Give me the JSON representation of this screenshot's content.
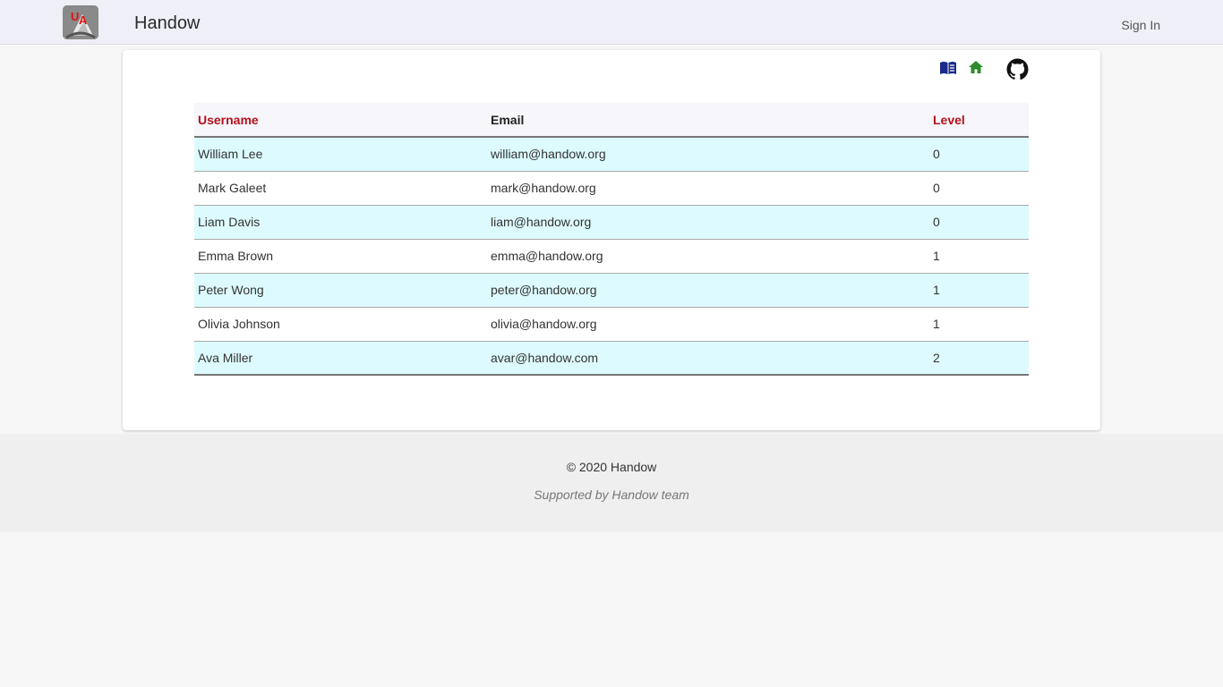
{
  "header": {
    "app_name": "Handow",
    "sign_in_label": "Sign In",
    "logo_icon": "handow-logo"
  },
  "toolbar": {
    "icons": [
      "book-icon",
      "home-icon",
      "github-icon"
    ],
    "colors": {
      "book": "#1a2b8a",
      "home": "#2e8b2e",
      "github": "#111111"
    }
  },
  "table": {
    "columns": [
      {
        "label": "Username",
        "sortable": true
      },
      {
        "label": "Email",
        "sortable": false
      },
      {
        "label": "Level",
        "sortable": true
      }
    ],
    "rows": [
      {
        "username": "William Lee",
        "email": "william@handow.org",
        "level": "0"
      },
      {
        "username": "Mark Galeet",
        "email": "mark@handow.org",
        "level": "0"
      },
      {
        "username": "Liam Davis",
        "email": "liam@handow.org",
        "level": "0"
      },
      {
        "username": "Emma Brown",
        "email": "emma@handow.org",
        "level": "1"
      },
      {
        "username": "Peter Wong",
        "email": "peter@handow.org",
        "level": "1"
      },
      {
        "username": "Olivia Johnson",
        "email": "olivia@handow.org",
        "level": "1"
      },
      {
        "username": "Ava Miller",
        "email": "avar@handow.com",
        "level": "2"
      }
    ],
    "colors": {
      "sort_header": "#b5121b",
      "alt_row": "#ddfbff",
      "header_bg": "#f6f6fb"
    }
  },
  "footer": {
    "copyright": "© 2020 Handow",
    "support": "Supported by Handow team"
  }
}
